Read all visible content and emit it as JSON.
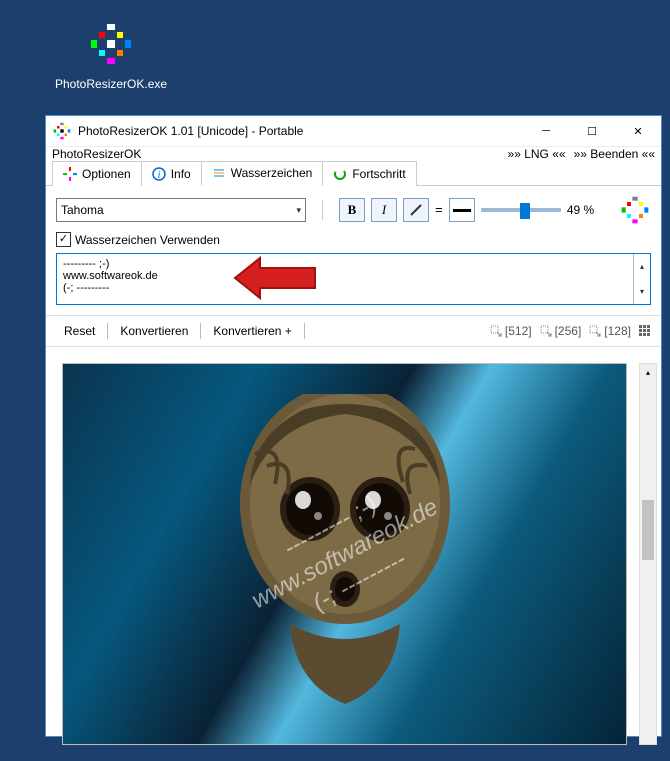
{
  "desktop": {
    "icon_label": "PhotoResizerOK.exe"
  },
  "window": {
    "title": "PhotoResizerOK 1.01 [Unicode] - Portable",
    "menu_app": "PhotoResizerOK",
    "menu_lng": "»» LNG ««",
    "menu_exit": "»» Beenden ««"
  },
  "tabs": {
    "t0": "Optionen",
    "t1": "Info",
    "t2": "Wasserzeichen",
    "t3": "Fortschritt"
  },
  "panel": {
    "font": "Tahoma",
    "bold": "B",
    "italic": "I",
    "equals": "=",
    "percent": "49 %",
    "use_watermark": "Wasserzeichen Verwenden",
    "textarea": "--------- ;-)\nwww.softwareok.de\n(-; ---------"
  },
  "toolbar": {
    "reset": "Reset",
    "convert": "Konvertieren",
    "convert_plus": "Konvertieren +",
    "s1": "[512]",
    "s2": "[256]",
    "s3": "[128]"
  },
  "preview": {
    "watermark_text": "--------- ;-)\nwww.softwareok.de\n(-; ---------"
  }
}
